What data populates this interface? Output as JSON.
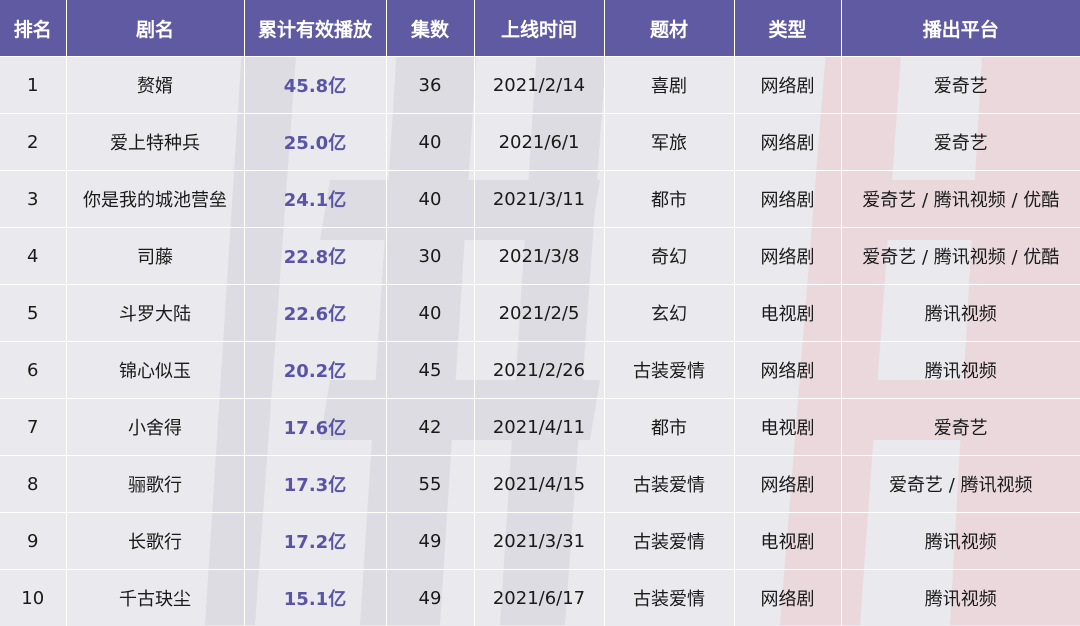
{
  "headers": [
    "排名",
    "剧名",
    "累计有效播放",
    "集数",
    "上线时间",
    "题材",
    "类型",
    "播出平台"
  ],
  "rows": [
    {
      "rank": "1",
      "title": "赘婿",
      "plays": "45.8亿",
      "episodes": "36",
      "date": "2021/2/14",
      "genre": "喜剧",
      "type": "网络剧",
      "platform": "爱奇艺"
    },
    {
      "rank": "2",
      "title": "爱上特种兵",
      "plays": "25.0亿",
      "episodes": "40",
      "date": "2021/6/1",
      "genre": "军旅",
      "type": "网络剧",
      "platform": "爱奇艺"
    },
    {
      "rank": "3",
      "title": "你是我的城池营垒",
      "plays": "24.1亿",
      "episodes": "40",
      "date": "2021/3/11",
      "genre": "都市",
      "type": "网络剧",
      "platform": "爱奇艺 / 腾讯视频 / 优酷"
    },
    {
      "rank": "4",
      "title": "司藤",
      "plays": "22.8亿",
      "episodes": "30",
      "date": "2021/3/8",
      "genre": "奇幻",
      "type": "网络剧",
      "platform": "爱奇艺 / 腾讯视频 / 优酷"
    },
    {
      "rank": "5",
      "title": "斗罗大陆",
      "plays": "22.6亿",
      "episodes": "40",
      "date": "2021/2/5",
      "genre": "玄幻",
      "type": "电视剧",
      "platform": "腾讯视频"
    },
    {
      "rank": "6",
      "title": "锦心似玉",
      "plays": "20.2亿",
      "episodes": "45",
      "date": "2021/2/26",
      "genre": "古装爱情",
      "type": "网络剧",
      "platform": "腾讯视频"
    },
    {
      "rank": "7",
      "title": "小舍得",
      "plays": "17.6亿",
      "episodes": "42",
      "date": "2021/4/11",
      "genre": "都市",
      "type": "电视剧",
      "platform": "爱奇艺"
    },
    {
      "rank": "8",
      "title": "骊歌行",
      "plays": "17.3亿",
      "episodes": "55",
      "date": "2021/4/15",
      "genre": "古装爱情",
      "type": "网络剧",
      "platform": "爱奇艺 / 腾讯视频"
    },
    {
      "rank": "9",
      "title": "长歌行",
      "plays": "17.2亿",
      "episodes": "49",
      "date": "2021/3/31",
      "genre": "古装爱情",
      "type": "电视剧",
      "platform": "腾讯视频"
    },
    {
      "rank": "10",
      "title": "千古玦尘",
      "plays": "15.1亿",
      "episodes": "49",
      "date": "2021/6/17",
      "genre": "古装爱情",
      "type": "网络剧",
      "platform": "腾讯视频"
    }
  ]
}
